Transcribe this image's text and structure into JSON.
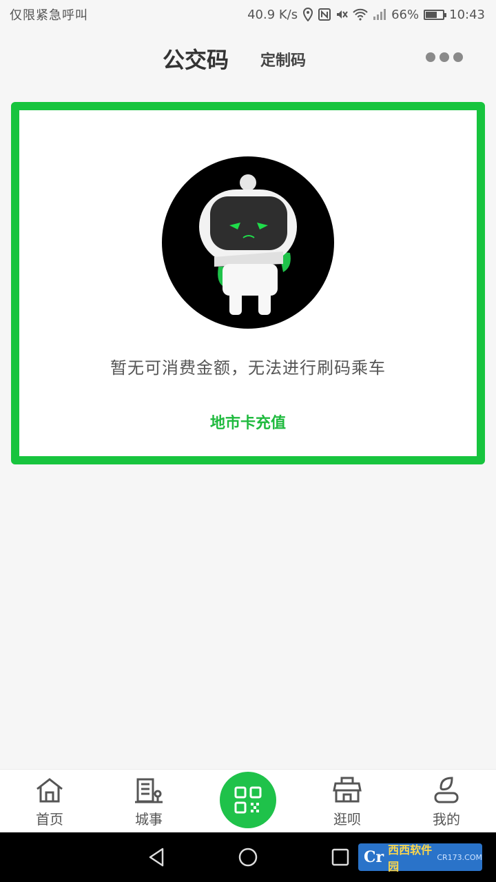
{
  "status_bar": {
    "left_text": "仅限紧急呼叫",
    "network_speed": "40.9 K/s",
    "battery_percent": "66%",
    "battery_level": 0.66,
    "time": "10:43"
  },
  "header": {
    "active_tab": "公交码",
    "inactive_tab": "定制码",
    "more_icon": "more-dots-icon"
  },
  "card": {
    "illustration": "robot-astronaut-icon",
    "message": "暂无可消费金额，无法进行刷码乘车",
    "recharge_label": "地市卡充值"
  },
  "bottom_nav": {
    "items": [
      {
        "label": "首页",
        "icon": "home-icon"
      },
      {
        "label": "城事",
        "icon": "building-icon"
      },
      {
        "label": "",
        "icon": "qr-code-icon"
      },
      {
        "label": "逛呗",
        "icon": "shop-icon"
      },
      {
        "label": "我的",
        "icon": "profile-icon"
      }
    ]
  },
  "system_nav": {
    "back_icon": "back-triangle-icon",
    "home_icon": "home-circle-icon",
    "recent_icon": "recent-square-icon"
  },
  "watermark": {
    "logo_text": "Cr",
    "brand_text": "西西软件园",
    "sub_text": "CR173.COM"
  },
  "colors": {
    "accent": "#1fc24a",
    "card_border": "#17c43e",
    "background": "#f6f6f6"
  }
}
